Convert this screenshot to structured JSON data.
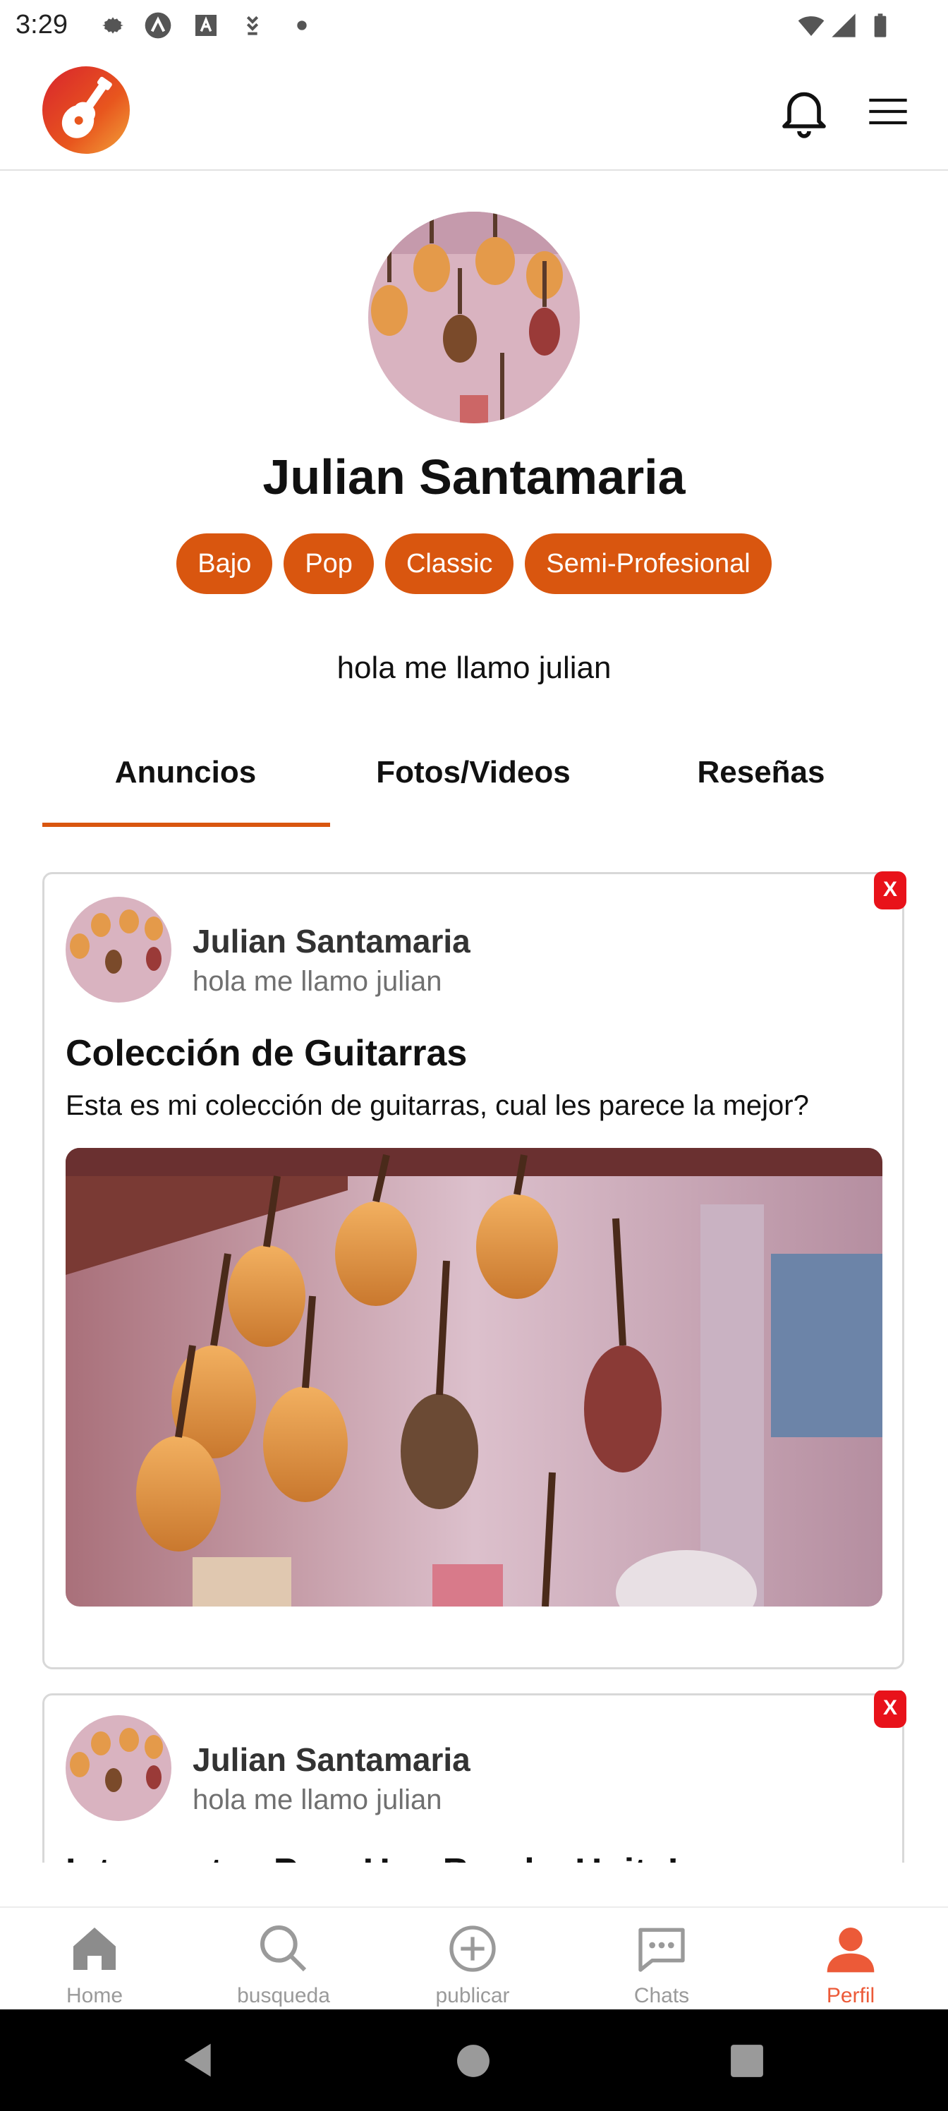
{
  "status_bar": {
    "time": "3:29"
  },
  "header": {
    "logo_icon": "guitar-logo-icon",
    "bell_icon": "bell-icon",
    "menu_icon": "hamburger-menu-icon"
  },
  "profile": {
    "name": "Julian Santamaria",
    "tags": [
      "Bajo",
      "Pop",
      "Classic",
      "Semi-Profesional"
    ],
    "bio": "hola me llamo julian"
  },
  "tabs": [
    {
      "label": "Anuncios",
      "active": true
    },
    {
      "label": "Fotos/Videos",
      "active": false
    },
    {
      "label": "Reseñas",
      "active": false
    }
  ],
  "posts": [
    {
      "author": "Julian Santamaria",
      "subtitle": "hola me llamo julian",
      "title": "Colección de Guitarras",
      "description": "Esta es mi colección de guitarras, cual les parece la mejor?",
      "close_label": "X"
    },
    {
      "author": "Julian Santamaria",
      "subtitle": "hola me llamo julian",
      "title": "Integrantes Para Una Banda, Unite!",
      "close_label": "X"
    }
  ],
  "bottom_nav": [
    {
      "label": "Home",
      "icon": "home-icon",
      "active": false
    },
    {
      "label": "busqueda",
      "icon": "search-icon",
      "active": false
    },
    {
      "label": "publicar",
      "icon": "add-circle-icon",
      "active": false
    },
    {
      "label": "Chats",
      "icon": "chat-icon",
      "active": false
    },
    {
      "label": "Perfil",
      "icon": "person-icon",
      "active": true
    }
  ],
  "colors": {
    "accent": "#d9560f",
    "close": "#e8121a",
    "nav_active": "#ec5a38"
  }
}
